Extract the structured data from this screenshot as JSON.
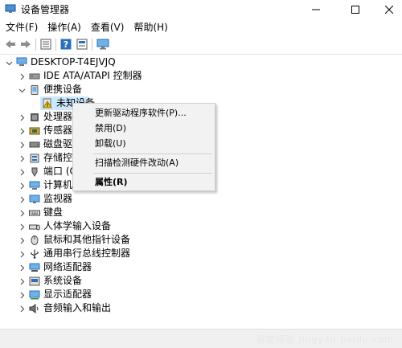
{
  "window": {
    "title": "设备管理器"
  },
  "menubar": {
    "items": [
      {
        "label": "文件(F)"
      },
      {
        "label": "操作(A)"
      },
      {
        "label": "查看(V)"
      },
      {
        "label": "帮助(H)"
      }
    ]
  },
  "toolbar": {
    "buttons": [
      "back-icon",
      "forward-icon",
      "properties-icon",
      "help-icon",
      "update-icon",
      "computer-monitor-icon"
    ]
  },
  "tree": {
    "root": "DESKTOP-T4EJVJQ",
    "items": [
      {
        "label": "IDE ATA/ATAPI 控制器",
        "expanded": false
      },
      {
        "label": "便携设备",
        "expanded": true
      },
      {
        "label": "未知设备",
        "child": true
      },
      {
        "label": "处理器",
        "expanded": false
      },
      {
        "label": "传感器",
        "expanded": false
      },
      {
        "label": "磁盘驱",
        "expanded": false
      },
      {
        "label": "存储控",
        "expanded": false
      },
      {
        "label": "端口 (C",
        "expanded": false
      },
      {
        "label": "计算机",
        "expanded": false
      },
      {
        "label": "监视器",
        "expanded": false
      },
      {
        "label": "键盘",
        "expanded": false
      },
      {
        "label": "人体学输入设备",
        "expanded": false
      },
      {
        "label": "鼠标和其他指针设备",
        "expanded": false
      },
      {
        "label": "通用串行总线控制器",
        "expanded": false
      },
      {
        "label": "网络适配器",
        "expanded": false
      },
      {
        "label": "系统设备",
        "expanded": false
      },
      {
        "label": "显示适配器",
        "expanded": false
      },
      {
        "label": "音频输入和输出",
        "expanded": false
      }
    ]
  },
  "context_menu": {
    "items": [
      {
        "label": "更新驱动程序软件(P)..."
      },
      {
        "label": "禁用(D)"
      },
      {
        "label": "卸载(U)"
      },
      {
        "label": "扫描检测硬件改动(A)"
      },
      {
        "label": "属性(R)"
      }
    ]
  },
  "statusbar": {
    "watermark": "百度经验 jingyan.baidu.com"
  },
  "colors": {
    "selection": "#cce8ff",
    "menu_bg": "#f2f2f2",
    "icon_blue": "#2b6fb8"
  }
}
